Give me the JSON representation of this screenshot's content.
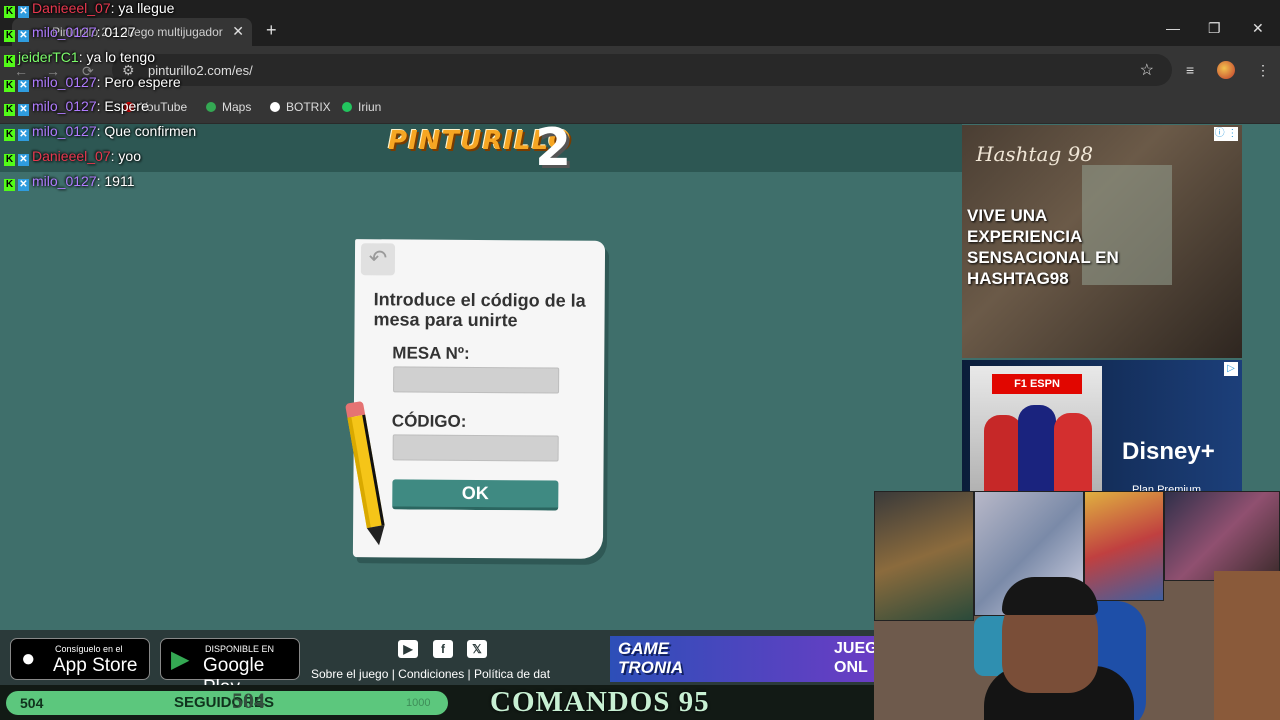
{
  "browser": {
    "tab_title": "Pinturillo 2 – Juego multijugador",
    "new_tab": "+",
    "tab_close": "✕",
    "window_controls": [
      "—",
      "❐",
      "✕"
    ],
    "url": "pinturillo2.com/es/",
    "bookmarks": [
      {
        "label": "YouTube",
        "color": "#ff0000"
      },
      {
        "label": "Maps",
        "color": "#34a853"
      },
      {
        "label": "BOTRIX",
        "color": "#ffffff"
      },
      {
        "label": "Iriun",
        "color": "#22c55e"
      }
    ]
  },
  "chat": {
    "messages": [
      {
        "badges": [
          "k",
          "v"
        ],
        "user": "Danieeel_07",
        "color": "#e8384f",
        "text": ": ya llegue"
      },
      {
        "badges": [
          "k",
          "v"
        ],
        "user": "milo_0127",
        "color": "#b07cff",
        "text": ": 0127"
      },
      {
        "badges": [
          "k"
        ],
        "user": "jeiderTC1",
        "color": "#7cfc6b",
        "text": ": ya lo tengo"
      },
      {
        "badges": [
          "k",
          "v"
        ],
        "user": "milo_0127",
        "color": "#b07cff",
        "text": ": Pero espere"
      },
      {
        "badges": [
          "k",
          "v"
        ],
        "user": "milo_0127",
        "color": "#b07cff",
        "text": ": Espere"
      },
      {
        "badges": [
          "k",
          "v"
        ],
        "user": "milo_0127",
        "color": "#b07cff",
        "text": ": Que confirmen"
      },
      {
        "badges": [
          "k",
          "v"
        ],
        "user": "Danieeel_07",
        "color": "#e8384f",
        "text": ": yoo"
      },
      {
        "badges": [
          "k",
          "v"
        ],
        "user": "milo_0127",
        "color": "#b07cff",
        "text": ": 1911"
      }
    ]
  },
  "game": {
    "logo_text": "PINTURILLO",
    "logo_number": "2",
    "join_form": {
      "back_icon": "↶",
      "title": "Introduce el código de la mesa para unirte",
      "table_label": "MESA Nº:",
      "table_value": "",
      "code_label": "CÓDIGO:",
      "code_value": "",
      "ok_label": "OK"
    }
  },
  "footer": {
    "app_store_small": "Consíguelo en el",
    "app_store_big": "App Store",
    "google_play_small": "DISPONIBLE EN",
    "google_play_big": "Google Play",
    "social_icons": [
      "youtube-icon",
      "facebook-icon",
      "x-icon"
    ],
    "social_glyphs": [
      "▶",
      "f",
      "𝕏"
    ],
    "links": "Sobre el juego | Condiciones | Política de dat",
    "gametronia_line1": "GAME",
    "gametronia_line2": "TRONIA",
    "gametronia_side": "JUEG ONL"
  },
  "ads": {
    "hashtag": {
      "brand": "Hashtag 98",
      "text": "VIVE UNA EXPERIENCIA SENSACIONAL EN HASHTAG98",
      "info": "ⓘ ⋮"
    },
    "disney": {
      "poster_label": "F1 ESPN",
      "logo": "Disney+",
      "plan": "Plan Premium"
    }
  },
  "stream_goal": {
    "left_count": "504",
    "label": "SEGUIDORES",
    "overlay_count": "504",
    "right_count": "1000",
    "progress": 0.504,
    "commands": "COMANDOS 95"
  },
  "colors": {
    "game_bg": "#3f6f6b",
    "ok_button": "#3f8a82",
    "kick_badge": "#53fc18",
    "goal_bar": "#5cc77d"
  }
}
